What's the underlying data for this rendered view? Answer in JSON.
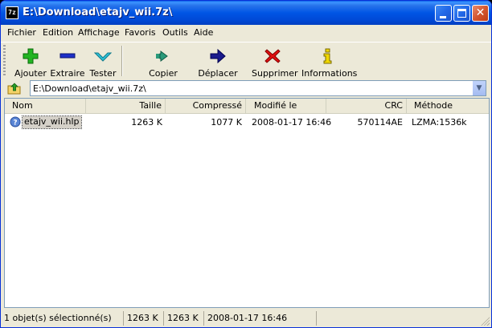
{
  "window": {
    "title": "E:\\Download\\etajv_wii.7z\\",
    "app_icon_text": "7z"
  },
  "menu": [
    "Fichier",
    "Edition",
    "Affichage",
    "Favoris",
    "Outils",
    "Aide"
  ],
  "toolbar": {
    "ajouter": "Ajouter",
    "extraire": "Extraire",
    "tester": "Tester",
    "copier": "Copier",
    "deplacer": "Déplacer",
    "supprimer": "Supprimer",
    "informations": "Informations"
  },
  "address": {
    "value": "E:\\Download\\etajv_wii.7z\\"
  },
  "columns": {
    "nom": "Nom",
    "taille": "Taille",
    "compresse": "Compressé",
    "modifie": "Modifié le",
    "crc": "CRC",
    "methode": "Méthode"
  },
  "files": [
    {
      "name": "etajv_wii.hlp",
      "size": "1263 K",
      "packed": "1077 K",
      "modified": "2008-01-17 16:46",
      "crc": "570114AE",
      "method": "LZMA:1536k"
    }
  ],
  "status": {
    "selection": "1 objet(s) sélectionné(s)",
    "size": "1263 K",
    "size2": "1263 K",
    "date": "2008-01-17 16:46"
  },
  "colors": {
    "titlebar": "#0055e5",
    "selection": "#d4d0c8",
    "chrome": "#ece9d8"
  }
}
